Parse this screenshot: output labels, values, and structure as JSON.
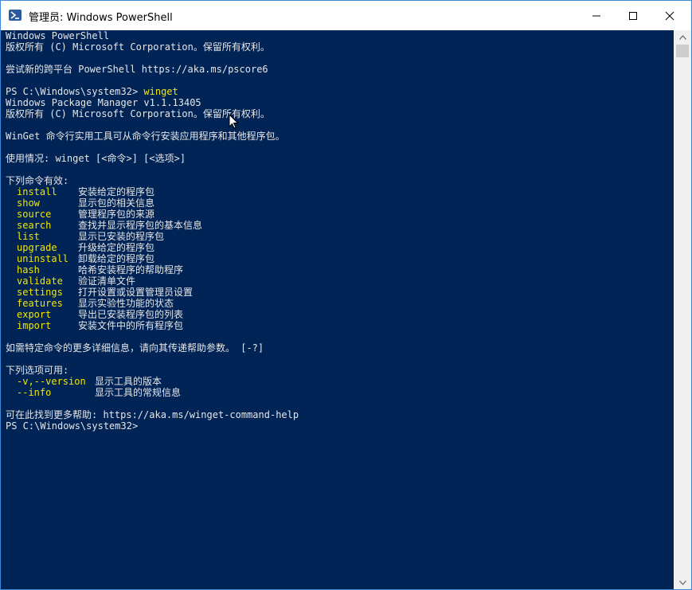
{
  "window": {
    "title": "管理员: Windows PowerShell",
    "icon": "powershell-icon",
    "buttons": {
      "minimize": "minimize-icon",
      "maximize": "maximize-icon",
      "close": "close-icon"
    }
  },
  "console": {
    "header_lines": [
      "Windows PowerShell",
      "版权所有 (C) Microsoft Corporation。保留所有权利。",
      "",
      "尝试新的跨平台 PowerShell https://aka.ms/pscore6",
      ""
    ],
    "prompt": "PS C:\\Windows\\system32> ",
    "typed_command": "winget",
    "output_lines": [
      "Windows Package Manager v1.1.13405",
      "版权所有 (C) Microsoft Corporation。保留所有权利。",
      "",
      "WinGet 命令行实用工具可从命令行安装应用程序和其他程序包。",
      "",
      "使用情况: winget [<命令>] [<选项>]",
      "",
      "下列命令有效:"
    ],
    "commands": [
      {
        "name": "install",
        "desc": "安装给定的程序包"
      },
      {
        "name": "show",
        "desc": "显示包的相关信息"
      },
      {
        "name": "source",
        "desc": "管理程序包的来源"
      },
      {
        "name": "search",
        "desc": "查找并显示程序包的基本信息"
      },
      {
        "name": "list",
        "desc": "显示已安装的程序包"
      },
      {
        "name": "upgrade",
        "desc": "升级给定的程序包"
      },
      {
        "name": "uninstall",
        "desc": "卸载给定的程序包"
      },
      {
        "name": "hash",
        "desc": "哈希安装程序的帮助程序"
      },
      {
        "name": "validate",
        "desc": "验证清单文件"
      },
      {
        "name": "settings",
        "desc": "打开设置或设置管理员设置"
      },
      {
        "name": "features",
        "desc": "显示实验性功能的状态"
      },
      {
        "name": "export",
        "desc": "导出已安装程序包的列表"
      },
      {
        "name": "import",
        "desc": "安装文件中的所有程序包"
      }
    ],
    "more_info": "如需特定命令的更多详细信息，请向其传递帮助参数。 [-?]",
    "options_header": "下列选项可用:",
    "options": [
      {
        "name": "-v,--version",
        "desc": "显示工具的版本"
      },
      {
        "name": "--info",
        "desc": "显示工具的常规信息"
      }
    ],
    "help_line": "可在此找到更多帮助: https://aka.ms/winget-command-help",
    "final_prompt": "PS C:\\Windows\\system32>"
  },
  "colors": {
    "console_bg": "#012456",
    "console_text": "#e6e6e6",
    "highlight": "#f2e600"
  }
}
